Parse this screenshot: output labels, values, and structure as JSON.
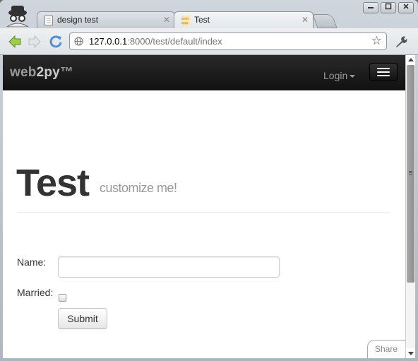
{
  "browser": {
    "tabs": [
      {
        "title": "design test",
        "active": false
      },
      {
        "title": "Test",
        "active": true
      }
    ],
    "window_controls": [
      "minimize",
      "maximize",
      "close"
    ],
    "address": {
      "host": "127.0.0.1",
      "path": ":8000/test/default/index"
    }
  },
  "page": {
    "navbar": {
      "brand_prefix": "web",
      "brand_bold": "2py",
      "brand_suffix": "™",
      "login_label": "Login"
    },
    "title": "Test",
    "subtitle": "customize me!",
    "form": {
      "name_label": "Name:",
      "name_value": "",
      "married_label": "Married:",
      "married_checked": false,
      "submit_label": "Submit"
    },
    "share_label": "Share"
  },
  "colors": {
    "navbar_bg": "#1b1b1b",
    "title": "#333333",
    "subtitle": "#999999"
  }
}
